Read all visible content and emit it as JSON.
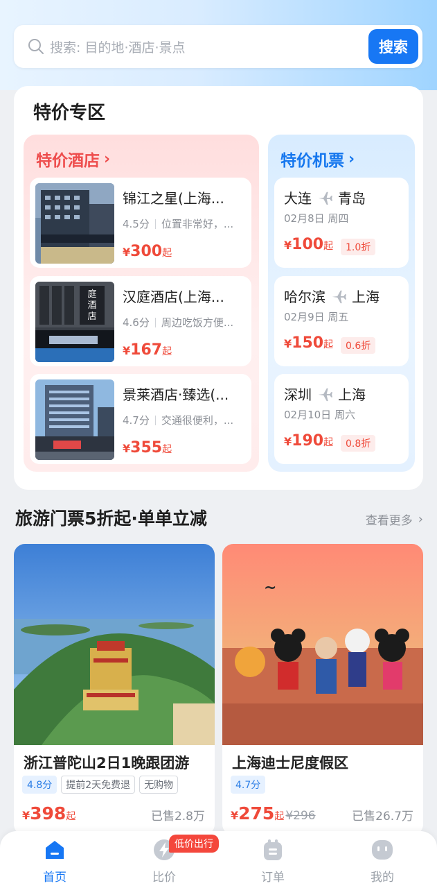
{
  "search": {
    "placeholder": "搜索: 目的地·酒店·景点",
    "button": "搜索"
  },
  "deals": {
    "title": "特价专区",
    "hotels_header": "特价酒店",
    "flights_header": "特价机票",
    "hotels": [
      {
        "name": "锦江之星(上海...",
        "score": "4.5分",
        "review": "位置非常好，...",
        "currency": "¥",
        "price": "300",
        "suffix": "起"
      },
      {
        "name": "汉庭酒店(上海...",
        "score": "4.6分",
        "review": "周边吃饭方便...",
        "currency": "¥",
        "price": "167",
        "suffix": "起"
      },
      {
        "name": "景莱酒店·臻选(...",
        "score": "4.7分",
        "review": "交通很便利，...",
        "currency": "¥",
        "price": "355",
        "suffix": "起"
      }
    ],
    "flights": [
      {
        "from": "大连",
        "to": "青岛",
        "date": "02月8日 周四",
        "currency": "¥",
        "price": "100",
        "suffix": "起",
        "discount": "1.0折"
      },
      {
        "from": "哈尔滨",
        "to": "上海",
        "date": "02月9日 周五",
        "currency": "¥",
        "price": "150",
        "suffix": "起",
        "discount": "0.6折"
      },
      {
        "from": "深圳",
        "to": "上海",
        "date": "02月10日 周六",
        "currency": "¥",
        "price": "190",
        "suffix": "起",
        "discount": "0.8折"
      }
    ]
  },
  "tickets": {
    "title": "旅游门票5折起·单单立减",
    "more": "查看更多",
    "items": [
      {
        "name": "浙江普陀山2日1晚跟团游",
        "score": "4.8分",
        "tags": [
          "提前2天免费退",
          "无购物"
        ],
        "currency": "¥",
        "price": "398",
        "suffix": "起",
        "original": "",
        "sold": "已售2.8万"
      },
      {
        "name": "上海迪士尼度假区",
        "score": "4.7分",
        "tags": [],
        "currency": "¥",
        "price": "275",
        "suffix": "起",
        "original": "¥296",
        "sold": "已售26.7万"
      }
    ]
  },
  "tabbar": {
    "badge": "低价出行",
    "tabs": [
      {
        "label": "首页",
        "icon": "home-icon",
        "active": true
      },
      {
        "label": "比价",
        "icon": "compare-icon",
        "active": false
      },
      {
        "label": "订单",
        "icon": "order-icon",
        "active": false
      },
      {
        "label": "我的",
        "icon": "profile-icon",
        "active": false
      }
    ]
  },
  "colors": {
    "accent": "#1777f4",
    "price": "#ef4a3a",
    "hotel_header": "#ee4d4d",
    "flight_header": "#1677ee"
  }
}
